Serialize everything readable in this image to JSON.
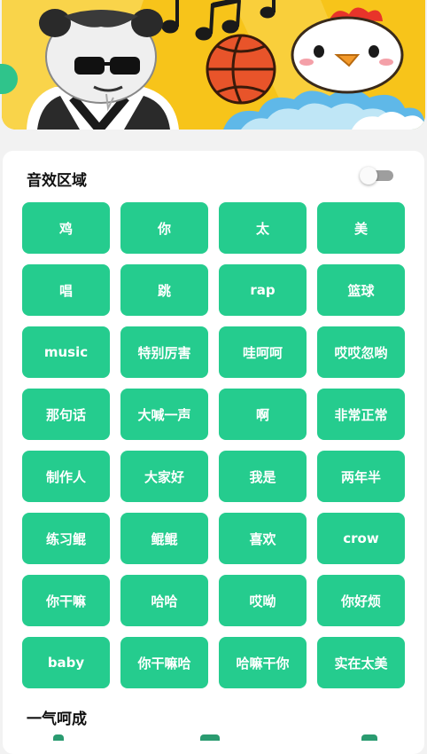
{
  "sections": {
    "sound_effects_title": "音效区域",
    "combo_title": "一气呵成"
  },
  "toggle": {
    "state": "off"
  },
  "sound_buttons": [
    "鸡",
    "你",
    "太",
    "美",
    "唱",
    "跳",
    "rap",
    "篮球",
    "music",
    "特别厉害",
    "哇呵呵",
    "哎哎忽哟",
    "那句话",
    "大喊一声",
    "啊",
    "非常正常",
    "制作人",
    "大家好",
    "我是",
    "两年半",
    "练习鲲",
    "鲲鲲",
    "喜欢",
    "crow",
    "你干嘛",
    "哈哈",
    "哎呦",
    "你好烦",
    "baby",
    "你干嘛哈",
    "哈嘛干你",
    "实在太美"
  ],
  "colors": {
    "accent": "#25cc8e",
    "banner_yellow": "#f7c41a",
    "basketball": "#e8542a",
    "page_bg": "#f2f2f2"
  },
  "icons": [
    "panda-meme-image",
    "music-notes-icon",
    "basketball-icon",
    "chicken-icon",
    "cloud-icon"
  ]
}
